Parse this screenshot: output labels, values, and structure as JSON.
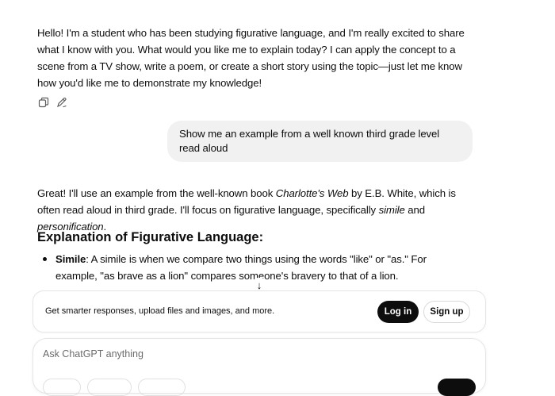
{
  "messages": {
    "assistant_intro": "Hello! I'm a student who has been studying figurative language, and I'm really excited to share what I know with you. What would you like me to explain today? I can apply the concept to a scene from a TV show, write a poem, or create a short story using the topic—just let me know how you'd like me to demonstrate my knowledge!",
    "user_prompt": "Show me an example from a well known third grade level read aloud",
    "assistant_reply": {
      "p1": "Great! I'll use an example from the well-known book ",
      "book_title": "Charlotte's Web",
      "p2": " by E.B. White, which is often read aloud in third grade. I'll focus on figurative language, specifically ",
      "term1": "simile",
      "p3": " and ",
      "term2": "personification",
      "p4": "."
    },
    "heading": "Explanation of Figurative Language:",
    "bullets": [
      {
        "term": "Simile",
        "text": ": A simile is when we compare two things using the words \"like\" or \"as.\" For example, \"as brave as a lion\" compares someone's bravery to that of a lion."
      }
    ]
  },
  "icons": {
    "copy": "copy-icon",
    "edit": "edit-icon",
    "scroll_down": "arrow-down-icon"
  },
  "scroll_glyph": "↓",
  "banner": {
    "text": "Get smarter responses, upload files and images, and more.",
    "login_label": "Log in",
    "signup_label": "Sign up"
  },
  "composer": {
    "placeholder": "Ask ChatGPT anything",
    "value": ""
  },
  "colors": {
    "user_bubble": "#f1f1f1",
    "primary_button": "#0d0d0d"
  }
}
